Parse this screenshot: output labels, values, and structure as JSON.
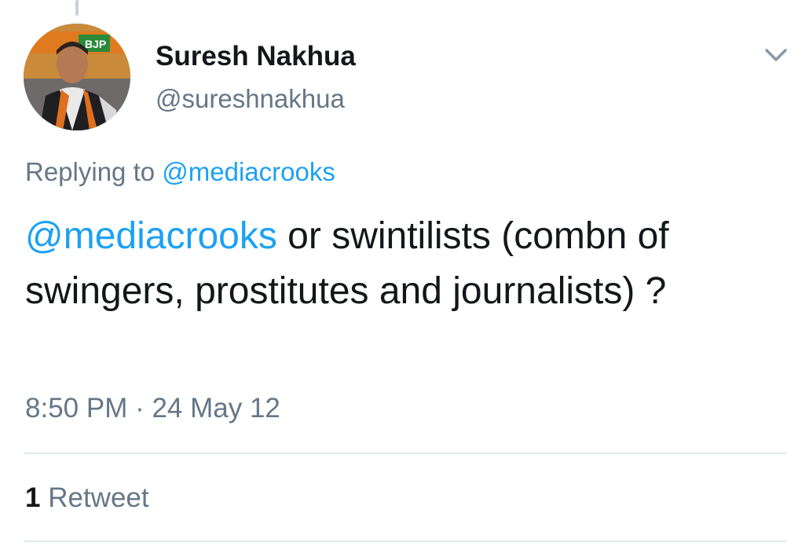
{
  "author": {
    "name": "Suresh Nakhua",
    "handle": "@sureshnakhua",
    "avatar_badge_text": "BJP"
  },
  "reply_context": {
    "prefix": "Replying to",
    "target": "@mediacrooks"
  },
  "tweet": {
    "mention": "@mediacrooks",
    "text": " or swintilists (combn of swingers, prostitutes and journalists) ?",
    "timestamp": "8:50 PM · 24 May 12"
  },
  "stats": {
    "retweet_count": "1",
    "retweet_label": "Retweet"
  },
  "icons": {
    "menu": "chevron-down-icon"
  },
  "colors": {
    "link": "#1da1f2",
    "secondary_text": "#657786",
    "primary_text": "#14171a",
    "divider": "#e1e8ed"
  }
}
